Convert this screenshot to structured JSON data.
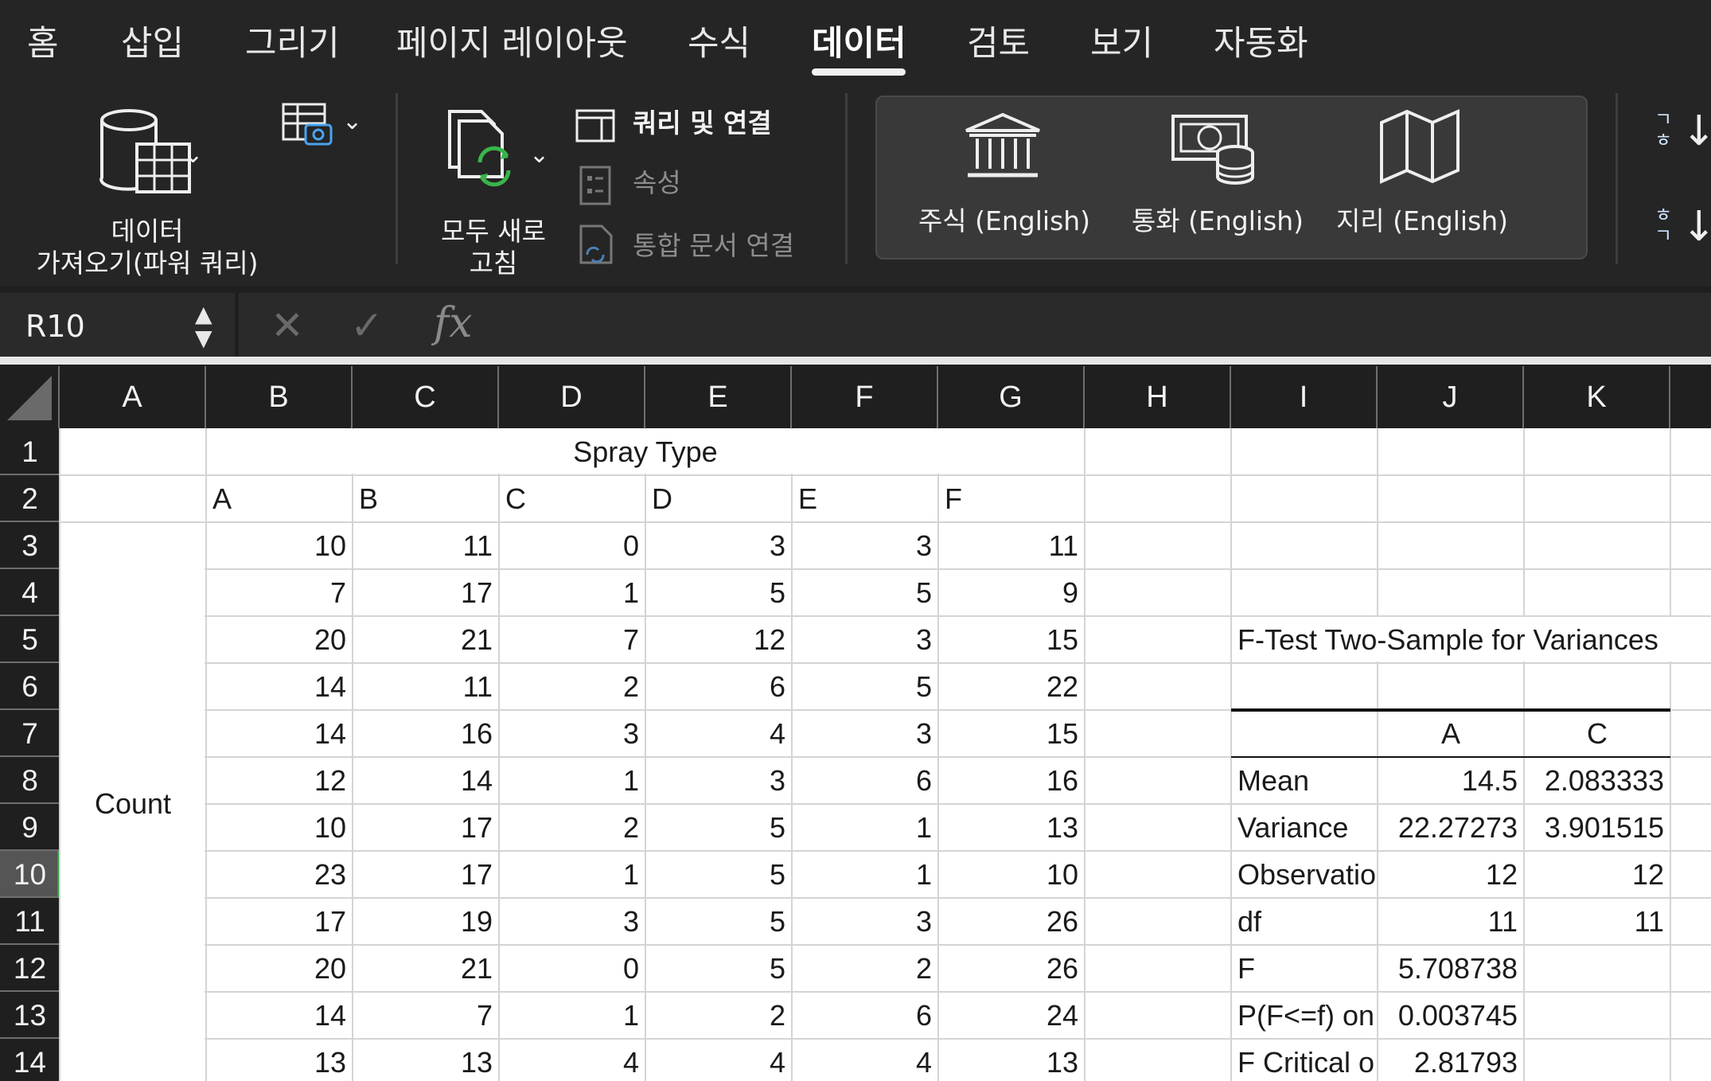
{
  "tabs": [
    "홈",
    "삽입",
    "그리기",
    "페이지 레이아웃",
    "수식",
    "데이터",
    "검토",
    "보기",
    "자동화"
  ],
  "active_tab": "데이터",
  "ribbon": {
    "get_data_label_1": "데이터",
    "get_data_label_2": "가져오기(파워 쿼리)",
    "refresh_label_1": "모두 새로",
    "refresh_label_2": "고침",
    "queries_label": "쿼리 및 연결",
    "properties_label": "속성",
    "workbook_links_label": "통합 문서 연결",
    "stocks_label": "주식 (English)",
    "currencies_label": "통화 (English)",
    "geography_label": "지리 (English)",
    "sort_asc_glyph": "ㄱ\nㅎ",
    "sort_desc_glyph": "ㅎ\nㄱ"
  },
  "formula_bar": {
    "name_box": "R10",
    "cancel_glyph": "✕",
    "enter_glyph": "✓",
    "fx_label": "fx",
    "formula": ""
  },
  "columns": [
    "A",
    "B",
    "C",
    "D",
    "E",
    "F",
    "G",
    "H",
    "I",
    "J",
    "K"
  ],
  "rows": [
    "1",
    "2",
    "3",
    "4",
    "5",
    "6",
    "7",
    "8",
    "9",
    "10",
    "11",
    "12",
    "13",
    "14"
  ],
  "selected_row": "10",
  "sheet": {
    "title": "Spray Type",
    "side_label": "Count",
    "headers": [
      "A",
      "B",
      "C",
      "D",
      "E",
      "F"
    ],
    "data": [
      [
        "10",
        "11",
        "0",
        "3",
        "3",
        "11"
      ],
      [
        "7",
        "17",
        "1",
        "5",
        "5",
        "9"
      ],
      [
        "20",
        "21",
        "7",
        "12",
        "3",
        "15"
      ],
      [
        "14",
        "11",
        "2",
        "6",
        "5",
        "22"
      ],
      [
        "14",
        "16",
        "3",
        "4",
        "3",
        "15"
      ],
      [
        "12",
        "14",
        "1",
        "3",
        "6",
        "16"
      ],
      [
        "10",
        "17",
        "2",
        "5",
        "1",
        "13"
      ],
      [
        "23",
        "17",
        "1",
        "5",
        "1",
        "10"
      ],
      [
        "17",
        "19",
        "3",
        "5",
        "3",
        "26"
      ],
      [
        "20",
        "21",
        "0",
        "5",
        "2",
        "26"
      ],
      [
        "14",
        "7",
        "1",
        "2",
        "6",
        "24"
      ],
      [
        "13",
        "13",
        "4",
        "4",
        "4",
        "13"
      ]
    ]
  },
  "ftest": {
    "title": "F-Test Two-Sample for Variances",
    "col_a": "A",
    "col_c": "C",
    "rows": [
      [
        "Mean",
        "14.5",
        "2.083333"
      ],
      [
        "Variance",
        "22.27273",
        "3.901515"
      ],
      [
        "Observatio",
        "12",
        "12"
      ],
      [
        "df",
        "11",
        "11"
      ],
      [
        "F",
        "5.708738",
        ""
      ],
      [
        "P(F<=f) on",
        "0.003745",
        ""
      ],
      [
        "F Critical o",
        "2.81793",
        ""
      ]
    ]
  }
}
